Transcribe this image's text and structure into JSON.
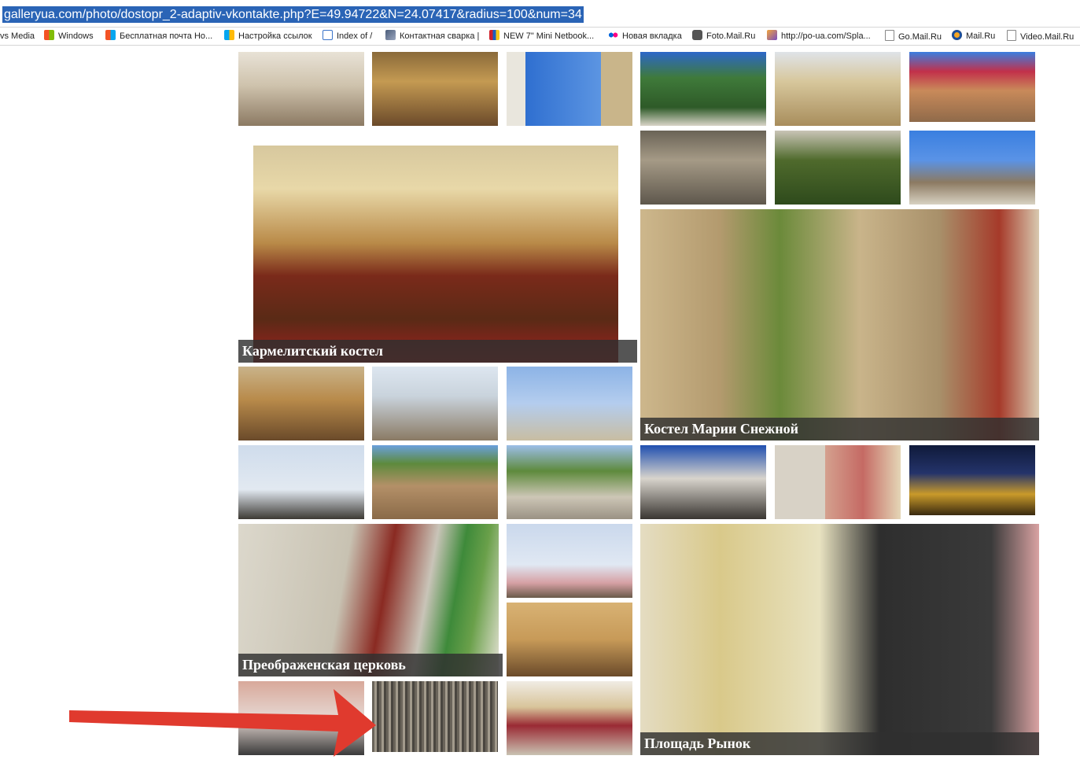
{
  "address_bar": {
    "url": "galleryua.com/photo/dostopr_2-adaptiv-vkontakte.php?E=49.94722&N=24.07417&radius=100&num=34"
  },
  "bookmarks": [
    {
      "label": "vs Media",
      "icon": "media-icon"
    },
    {
      "label": "Windows",
      "icon": "windows-icon"
    },
    {
      "label": "Бесплатная почта Но...",
      "icon": "windows-icon"
    },
    {
      "label": "Настройка ссылок",
      "icon": "windows-icon"
    },
    {
      "label": "Index of /",
      "icon": "index-icon"
    },
    {
      "label": "Контактная сварка |",
      "icon": "site-icon"
    },
    {
      "label": "NEW 7\" Mini Netbook...",
      "icon": "shop-icon"
    },
    {
      "label": "Новая вкладка",
      "icon": "flickr-icon"
    },
    {
      "label": "Foto.Mail.Ru",
      "icon": "camera-icon"
    },
    {
      "label": "http://po-ua.com/Spla...",
      "icon": "site-icon"
    },
    {
      "label": "Go.Mail.Ru",
      "icon": "page-icon"
    },
    {
      "label": "Mail.Ru",
      "icon": "mail-icon"
    },
    {
      "label": "Video.Mail.Ru",
      "icon": "page-icon"
    }
  ],
  "gallery": {
    "captions": {
      "karmelit": "Кармелитский костел",
      "maria": "Костел Марии Снежной",
      "preobr": "Преображенская церковь",
      "rynok": "Площадь Рынок"
    }
  },
  "colors": {
    "selection": "#2a64b6",
    "caption_bg": "#303030",
    "arrow": "#e03a2e"
  }
}
